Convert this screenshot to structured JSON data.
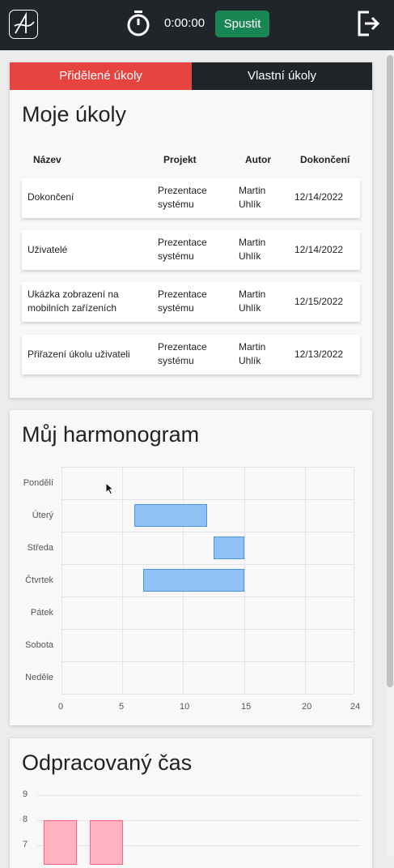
{
  "header": {
    "timer": "0:00:00",
    "start_label": "Spustit",
    "icons": [
      "logo-icon",
      "stopwatch-icon",
      "logout-icon"
    ]
  },
  "tabs": [
    {
      "label": "Přidělené úkoly",
      "active": true
    },
    {
      "label": "Vlastní úkoly",
      "active": false
    }
  ],
  "tasks": {
    "title": "Moje úkoly",
    "columns": [
      "Název",
      "Projekt",
      "Autor",
      "Dokončení"
    ],
    "rows": [
      {
        "name": "Dokončení",
        "project": "Prezentace systému",
        "author": "Martin Uhlík",
        "due": "12/14/2022"
      },
      {
        "name": "Uživatelé",
        "project": "Prezentace systému",
        "author": "Martin Uhlík",
        "due": "12/14/2022"
      },
      {
        "name": "Ukázka zobrazení na mobilních zařízeních",
        "project": "Prezentace systému",
        "author": "Martin Uhlík",
        "due": "12/15/2022"
      },
      {
        "name": "Přiřazení úkolu uživateli",
        "project": "Prezentace systému",
        "author": "Martin Uhlík",
        "due": "12/13/2022"
      }
    ]
  },
  "schedule": {
    "title": "Můj harmonogram",
    "chart_data": {
      "type": "bar",
      "orientation": "horizontal-floating",
      "categories": [
        "Pondělí",
        "Úterý",
        "Středa",
        "Čtvrtek",
        "Pátek",
        "Sobota",
        "Neděle"
      ],
      "ranges": [
        null,
        [
          6,
          12
        ],
        [
          12.5,
          15
        ],
        [
          6.7,
          15
        ],
        null,
        null,
        null
      ],
      "xlim": [
        0,
        24
      ],
      "xticks": [
        "0",
        "5",
        "10",
        "15",
        "20",
        "24"
      ],
      "color": "#90c2f5",
      "border_color": "#4a96e0",
      "grid": true
    }
  },
  "worked": {
    "title": "Odpracovaný čas",
    "chart_data": {
      "type": "bar",
      "values_visible": [
        8,
        8
      ],
      "ylim_visible": [
        7,
        9
      ],
      "yticks": [
        "9",
        "8",
        "7"
      ],
      "color": "#ffb3c1",
      "border_color": "#ff6384",
      "grid": true
    }
  }
}
